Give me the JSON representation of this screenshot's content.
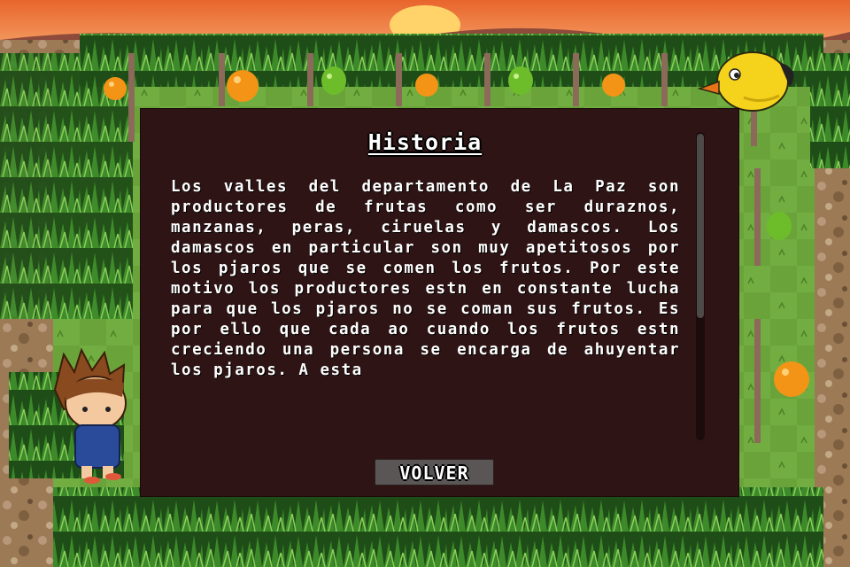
{
  "dialog": {
    "title": "Historia",
    "body": "Los valles del departamento de La Paz son productores de frutas como ser duraznos, manzanas, peras, ciruelas y damascos. Los damascos en particular son muy apetitosos por los pjaros que se comen los frutos. Por este motivo los productores estn en constante lucha para que los pjaros no se coman sus frutos. Es por ello que cada ao cuando los frutos estn creciendo una persona se encarga de ahuyentar los pjaros. A esta",
    "back_label": "VOLVER"
  },
  "scene": {
    "fruits": [
      "orange",
      "orange",
      "green-apple",
      "orange",
      "green-apple",
      "orange",
      "green-apple",
      "orange"
    ],
    "characters": [
      "boy-farmer",
      "yellow-bird"
    ]
  },
  "colors": {
    "dialog_bg": "#2e1414",
    "grass": "#6aa33a",
    "button_bg": "#5a5656",
    "sky_orange": "#e8652c"
  }
}
